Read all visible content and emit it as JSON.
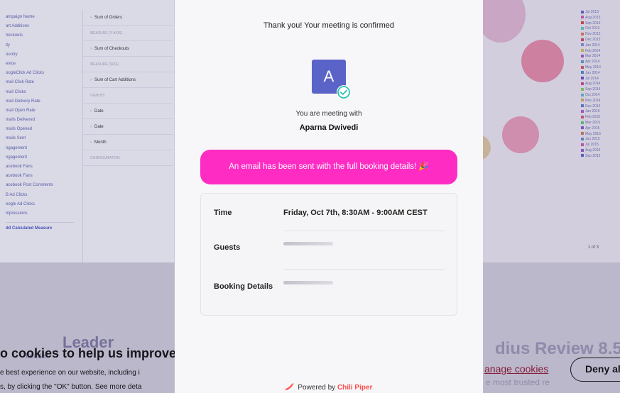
{
  "colors": {
    "accent_pink": "#ff2cc4",
    "avatar_bg": "#5a63c8",
    "check_teal": "#2bc4b0",
    "brand_red": "#ff4d4d"
  },
  "background": {
    "fields": [
      "ampaign Name",
      "art Additions",
      "heckouts",
      "ity",
      "ountry",
      "evice",
      "oogleClick Ad Clicks",
      "mail Click Rate",
      "mail Clicks",
      "mail Delivery Rate",
      "mail Open Rate",
      "mails Delivered",
      "mails Opened",
      "mails Sent",
      "ngagement",
      "ngagement",
      "acebook Fans",
      "acebook Fans",
      "acebook Post Comments",
      "B Ad Clicks",
      "oogle Ad Clicks",
      "mpressions"
    ],
    "add_measure": "dd Calculated Measure",
    "config_rows": [
      {
        "text": "Sum of Orders",
        "kind": "row"
      },
      {
        "text": "MEASURE (Y AXIS)",
        "kind": "label"
      },
      {
        "text": "Sum of Checkouts",
        "kind": "row"
      },
      {
        "text": "MEASURE (SIZE)",
        "kind": "label"
      },
      {
        "text": "Sum of Cart Additions",
        "kind": "row"
      },
      {
        "text": "VIEW BY",
        "kind": "label"
      },
      {
        "text": "Date",
        "kind": "row"
      },
      {
        "text": "Date",
        "kind": "row"
      },
      {
        "text": "Month",
        "kind": "row"
      },
      {
        "text": "CONFIGURATION",
        "kind": "label"
      }
    ],
    "legend": [
      {
        "label": "Jul 2013",
        "color": "#5a63c8"
      },
      {
        "label": "Aug 2013",
        "color": "#c85aa8"
      },
      {
        "label": "Sep 2013",
        "color": "#d24a4a"
      },
      {
        "label": "Oct 2013",
        "color": "#5ac8c0"
      },
      {
        "label": "Nov 2013",
        "color": "#d27a4a"
      },
      {
        "label": "Dec 2013",
        "color": "#c84a6a"
      },
      {
        "label": "Jan 2014",
        "color": "#8a8ad8"
      },
      {
        "label": "Feb 2014",
        "color": "#d8b84a"
      },
      {
        "label": "Mar 2014",
        "color": "#9a5ac8"
      },
      {
        "label": "Apr 2014",
        "color": "#5a9ac8"
      },
      {
        "label": "May 2014",
        "color": "#c85a5a"
      },
      {
        "label": "Jun 2014",
        "color": "#4a8ad2"
      },
      {
        "label": "Jul 2014",
        "color": "#6a4ac8"
      },
      {
        "label": "Aug 2014",
        "color": "#c84a9a"
      },
      {
        "label": "Sep 2014",
        "color": "#8ac85a"
      },
      {
        "label": "Oct 2014",
        "color": "#5ab8c8"
      },
      {
        "label": "Nov 2014",
        "color": "#c8a85a"
      },
      {
        "label": "Dec 2014",
        "color": "#5a7ac8"
      },
      {
        "label": "Jan 2015",
        "color": "#a85ac8"
      },
      {
        "label": "Feb 2015",
        "color": "#c85a7a"
      },
      {
        "label": "Mar 2015",
        "color": "#5ac87a"
      },
      {
        "label": "Apr 2015",
        "color": "#7a5ac8"
      },
      {
        "label": "May 2015",
        "color": "#c87a5a"
      },
      {
        "label": "Jun 2015",
        "color": "#5a8ac8"
      },
      {
        "label": "Jul 2015",
        "color": "#c85aa8"
      },
      {
        "label": "Aug 2015",
        "color": "#8a5ac8"
      },
      {
        "label": "Sep 2015",
        "color": "#5a63c8"
      }
    ],
    "pager": "1 of 3",
    "leader": "Leader",
    "leader_sub": "Leader",
    "review_text": "dius Review 8.5",
    "trusted_text": "e most trusted re"
  },
  "cookie_banner": {
    "title": "o cookies to help us improve t",
    "line1": "e best experience on our website, including i",
    "line2": "s, by clicking the \"OK\" button. See more deta",
    "manage_label": "anage cookies",
    "deny_label": "Deny al"
  },
  "modal": {
    "title": "Thank you! Your meeting is confirmed",
    "avatar_letter": "A",
    "meeting_with_label": "You are meeting with",
    "host_name": "Aparna Dwivedi",
    "email_notice": "An email has been sent with the full booking details! 🎉",
    "details": {
      "time_label": "Time",
      "time_value": "Friday, Oct 7th, 8:30AM - 9:00AM CEST",
      "guests_label": "Guests",
      "booking_label": "Booking Details"
    },
    "powered_prefix": "Powered by ",
    "powered_brand": "Chili Piper"
  }
}
